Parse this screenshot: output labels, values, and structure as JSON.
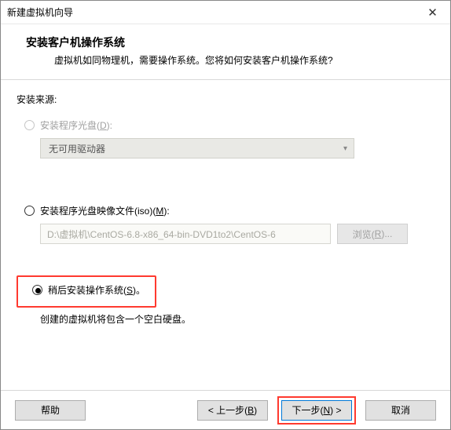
{
  "window": {
    "title": "新建虚拟机向导",
    "close_glyph": "✕"
  },
  "header": {
    "heading": "安装客户机操作系统",
    "sub": "虚拟机如同物理机，需要操作系统。您将如何安装客户机操作系统?"
  },
  "source": {
    "label": "安装来源:",
    "opt_disc": {
      "label_pre": "安装程序光盘(",
      "key": "D",
      "label_post": "):"
    },
    "drive_combo": "无可用驱动器",
    "opt_iso": {
      "label_pre": "安装程序光盘映像文件(iso)(",
      "key": "M",
      "label_post": "):"
    },
    "iso_path": "D:\\虚拟机\\CentOS-6.8-x86_64-bin-DVD1to2\\CentOS-6",
    "browse": {
      "pre": "浏览(",
      "key": "R",
      "post": ")..."
    },
    "opt_later": {
      "label_pre": "稍后安装操作系统(",
      "key": "S",
      "label_post": ")。"
    },
    "later_hint": "创建的虚拟机将包含一个空白硬盘。"
  },
  "footer": {
    "help": "帮助",
    "back": {
      "pre": "< 上一步(",
      "key": "B",
      "post": ")"
    },
    "next": {
      "pre": "下一步(",
      "key": "N",
      "post": ") >"
    },
    "cancel": "取消"
  }
}
